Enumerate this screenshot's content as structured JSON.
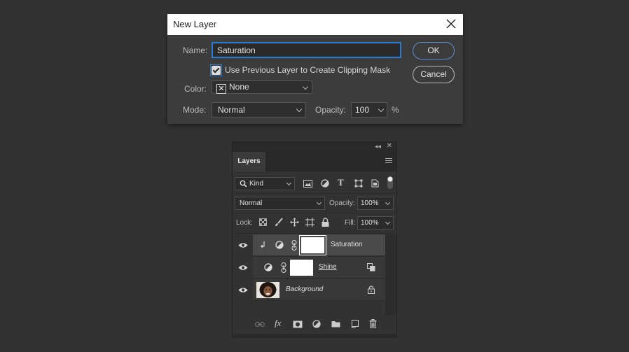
{
  "dialog": {
    "title": "New Layer",
    "name_label": "Name:",
    "name_value": "Saturation",
    "clipping_label": "Use Previous Layer to Create Clipping Mask",
    "clipping_checked": true,
    "color_label": "Color:",
    "color_value": "None",
    "mode_label": "Mode:",
    "mode_value": "Normal",
    "opacity_label": "Opacity:",
    "opacity_value": "100",
    "opacity_unit": "%",
    "ok_label": "OK",
    "cancel_label": "Cancel"
  },
  "layers_panel": {
    "tab_label": "Layers",
    "filter_kind": "Kind",
    "blend_mode": "Normal",
    "opacity_label": "Opacity:",
    "opacity_value": "100%",
    "lock_label": "Lock:",
    "fill_label": "Fill:",
    "fill_value": "100%",
    "layers": [
      {
        "name": "Saturation",
        "selected": true
      },
      {
        "name": "Shine",
        "selected": false
      },
      {
        "name": "Background",
        "selected": false
      }
    ]
  },
  "colors": {
    "accent": "#2a7bd3",
    "background": "#323232",
    "dialog_bg": "#3c3c3c",
    "selected_row": "#4a4a4a"
  }
}
